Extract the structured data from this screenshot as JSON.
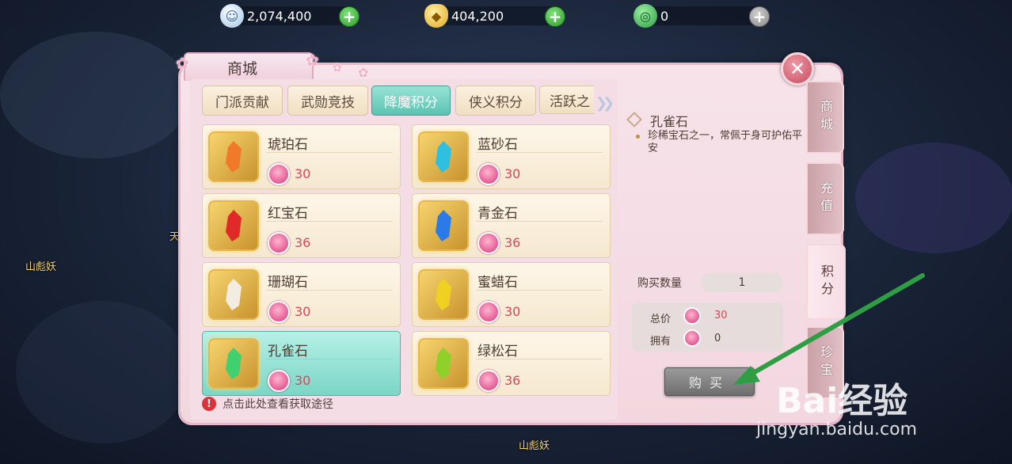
{
  "currencies": [
    {
      "icon": "silver-coin-icon",
      "value": "2,074,400",
      "add_enabled": true
    },
    {
      "icon": "gold-ingot-icon",
      "value": "404,200",
      "add_enabled": true
    },
    {
      "icon": "jade-icon",
      "value": "0",
      "add_enabled": false
    }
  ],
  "background_labels": {
    "npc_left": "山彪妖",
    "npc_bottom": "山彪妖",
    "npc_mid": "天"
  },
  "panel": {
    "title": "商城"
  },
  "tabs": [
    {
      "label": "门派贡献",
      "active": false
    },
    {
      "label": "武勋竞技",
      "active": false
    },
    {
      "label": "降魔积分",
      "active": true
    },
    {
      "label": "侠义积分",
      "active": false
    },
    {
      "label": "活跃之",
      "active": false
    }
  ],
  "items": [
    {
      "name": "琥珀石",
      "price": "30",
      "color": "#f07a2a",
      "selected": false
    },
    {
      "name": "蓝砂石",
      "price": "30",
      "color": "#2fc0e0",
      "selected": false
    },
    {
      "name": "红宝石",
      "price": "36",
      "color": "#e02a2a",
      "selected": false
    },
    {
      "name": "青金石",
      "price": "36",
      "color": "#2a7ae8",
      "selected": false
    },
    {
      "name": "珊瑚石",
      "price": "30",
      "color": "#f3ece2",
      "selected": false
    },
    {
      "name": "蜜蜡石",
      "price": "30",
      "color": "#f0d020",
      "selected": false
    },
    {
      "name": "孔雀石",
      "price": "30",
      "color": "#40d070",
      "selected": true
    },
    {
      "name": "绿松石",
      "price": "36",
      "color": "#8fd02a",
      "selected": false
    }
  ],
  "hint": "点击此处查看获取途径",
  "detail": {
    "name": "孔雀石",
    "description": "珍稀宝石之一，常佩于身可护佑平安",
    "quantity_label": "购买数量",
    "quantity": "1",
    "total_label": "总价",
    "total": "30",
    "owned_label": "拥有",
    "owned": "0",
    "buy_label": "购买"
  },
  "side_tabs": [
    {
      "label": "商城",
      "active": false
    },
    {
      "label": "充值",
      "active": false
    },
    {
      "label": "积分",
      "active": true
    },
    {
      "label": "珍宝",
      "active": false
    }
  ],
  "watermark": {
    "brand": "Bai经验",
    "url": "jingyan.baidu.com"
  },
  "colors": {
    "accent_teal": "#5cc3b2",
    "price_red": "#d24a5a",
    "arrow_green": "#2e9e45"
  }
}
